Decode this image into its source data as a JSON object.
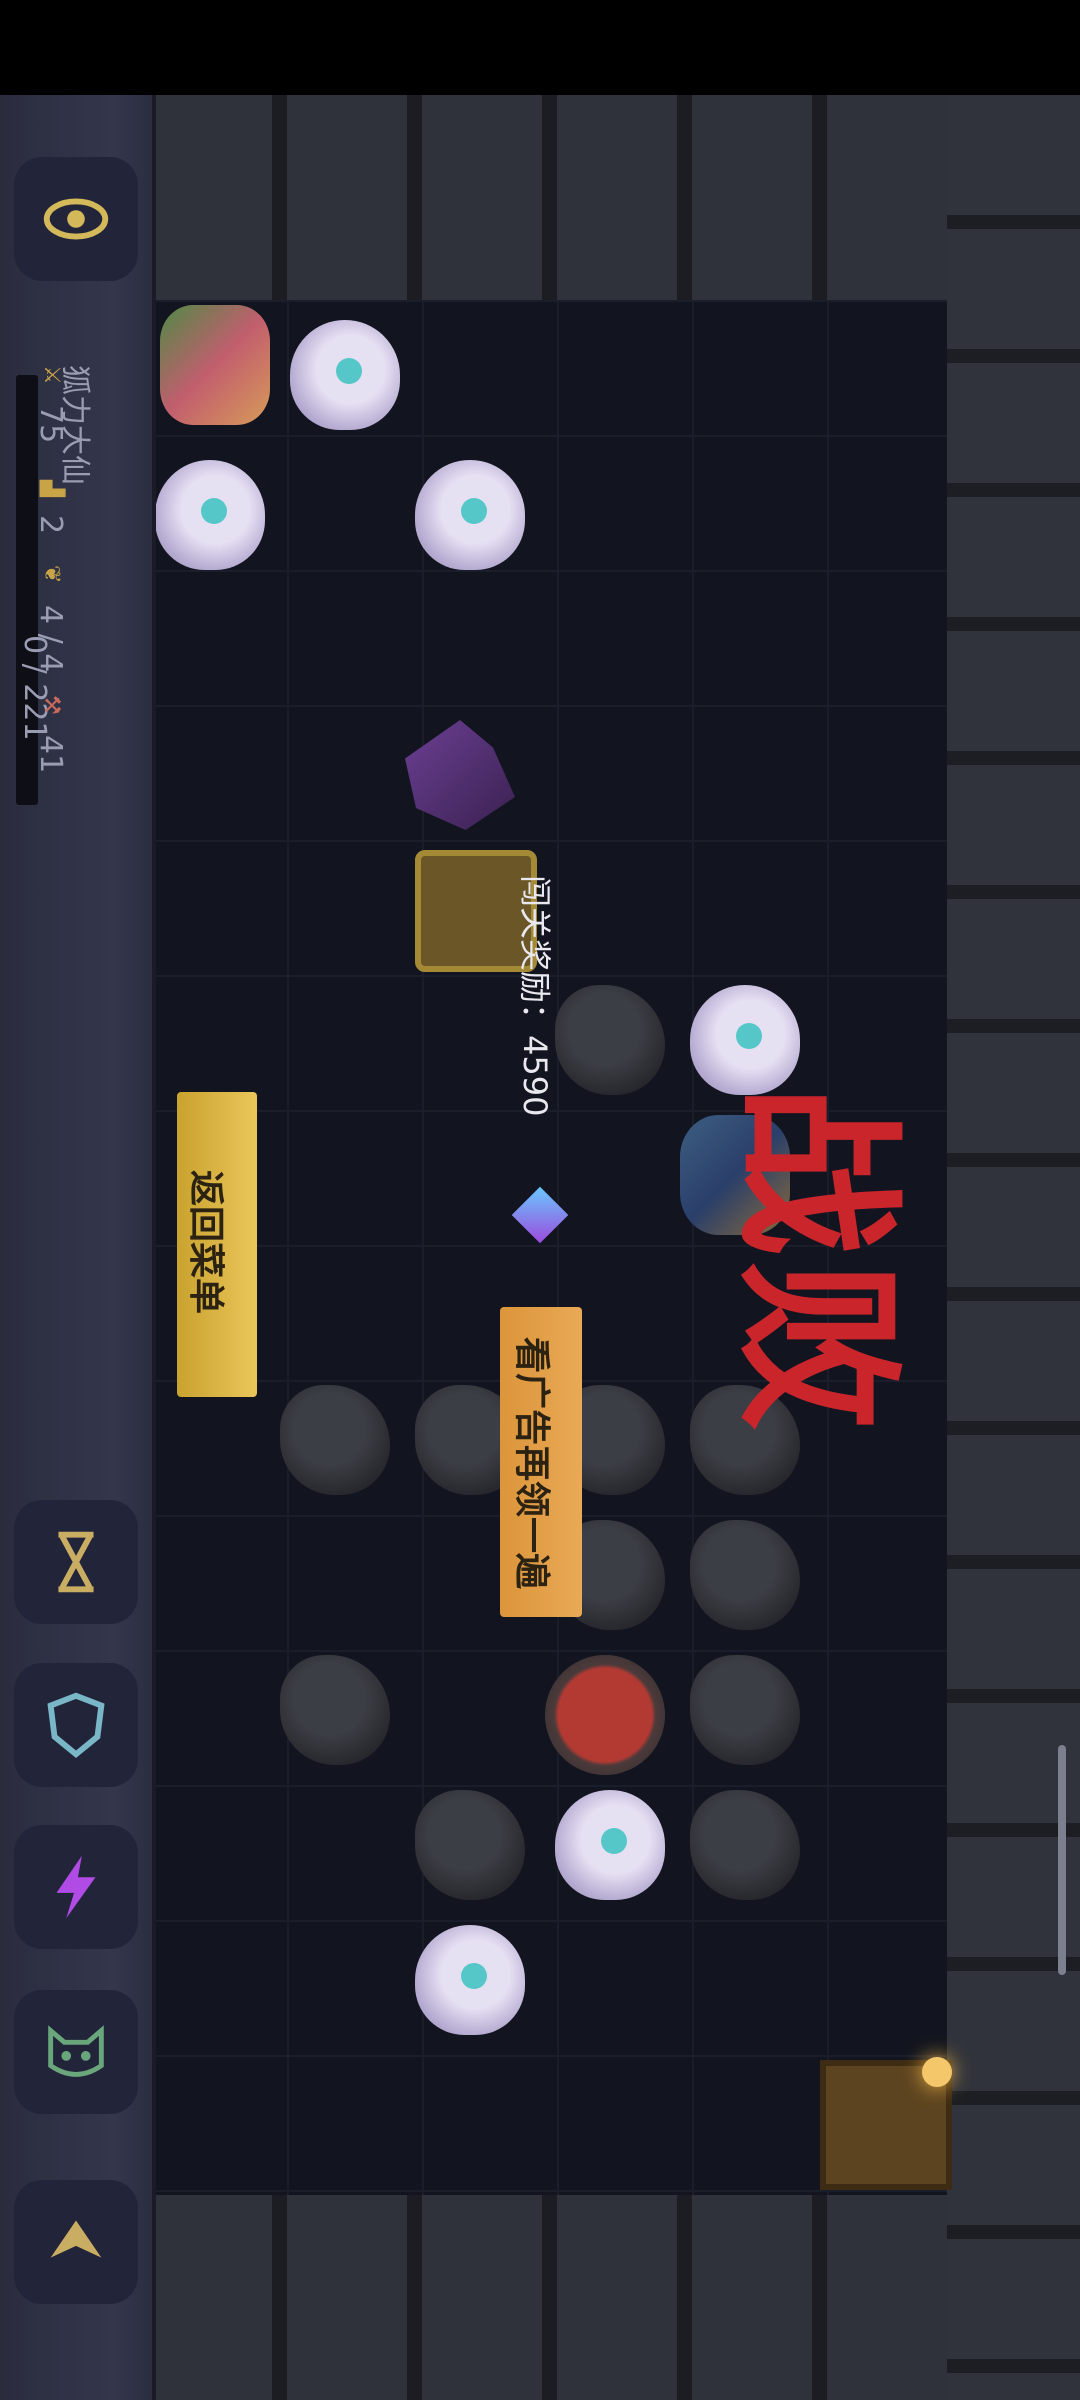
{
  "hud": {
    "hero_name": "狐力大仙",
    "attack": "75",
    "defense": "2",
    "energy": "4 / 4",
    "resource": "41",
    "experience": "0 / 221"
  },
  "result": {
    "title": "战败",
    "reward_label": "闯关奖励：",
    "reward_amount": "4590"
  },
  "buttons": {
    "watch_ad": "看广告再领一遍",
    "return_menu": "返回菜单"
  },
  "colors": {
    "defeat_text": "#c9252b",
    "ad_button": "#e3a04a",
    "menu_button": "#e3bd4c"
  },
  "icons": [
    "eye-icon",
    "sword-icon",
    "boot-icon",
    "wing-icon",
    "hammer-icon",
    "hourglass-icon",
    "shield-icon",
    "lightning-icon",
    "cat-icon",
    "arrow-up-icon"
  ]
}
